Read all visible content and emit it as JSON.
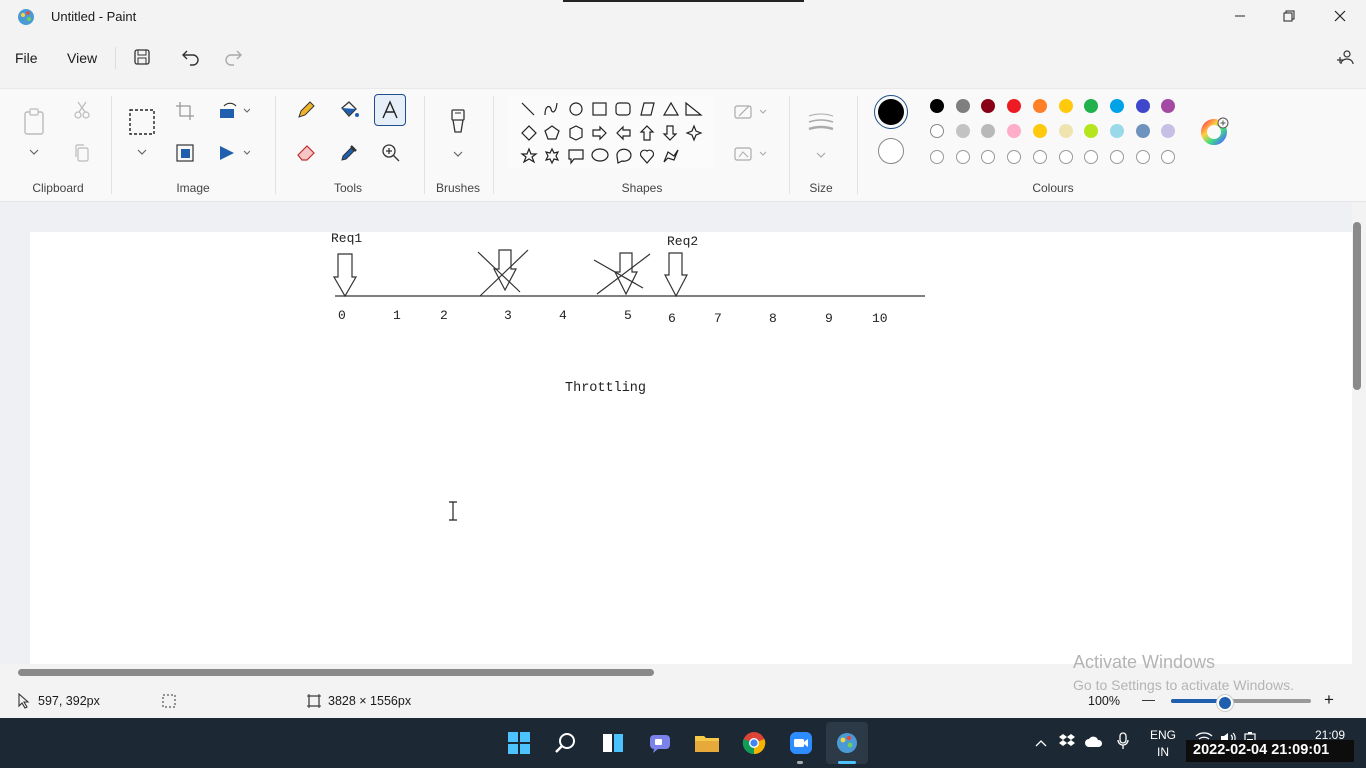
{
  "window": {
    "title": "Untitled - Paint",
    "minimize": "—",
    "restore": "❐",
    "close": "✕"
  },
  "menu": {
    "file": "File",
    "view": "View"
  },
  "ribbon": {
    "groups": {
      "clipboard": "Clipboard",
      "image": "Image",
      "tools": "Tools",
      "brushes": "Brushes",
      "shapes": "Shapes",
      "size": "Size",
      "colours": "Colours"
    },
    "palette_row1": [
      "#000000",
      "#7f7f7f",
      "#880015",
      "#ed1c24",
      "#ff7f27",
      "#ffc90e",
      "#22b14c",
      "#00a2e8",
      "#3f48cc",
      "#a349a4"
    ],
    "palette_row2": [
      "#ffffff",
      "#c3c3c3",
      "#b9b9b9",
      "#ffaec9",
      "#ffc90e",
      "#efe4b0",
      "#b5e61d",
      "#99d9ea",
      "#7092be",
      "#c8bfe7"
    ],
    "color1": "#000000",
    "color2": "#ffffff"
  },
  "drawing": {
    "req1": "Req1",
    "req2": "Req2",
    "ticks": [
      "0",
      "1",
      "2",
      "3",
      "4",
      "5",
      "6",
      "7",
      "8",
      "9",
      "10"
    ],
    "caption": "Throttling"
  },
  "status": {
    "cursor_pos": "597, 392px",
    "canvas_size": "3828 × 1556px",
    "zoom": "100%",
    "zoom_minus": "—",
    "zoom_plus": "+"
  },
  "watermark": {
    "line1": "Activate Windows",
    "line2": "Go to Settings to activate Windows."
  },
  "taskbar": {
    "lang1": "ENG",
    "lang2": "IN",
    "time": "21:09",
    "datetime": "2022-02-04 21:09:01"
  }
}
